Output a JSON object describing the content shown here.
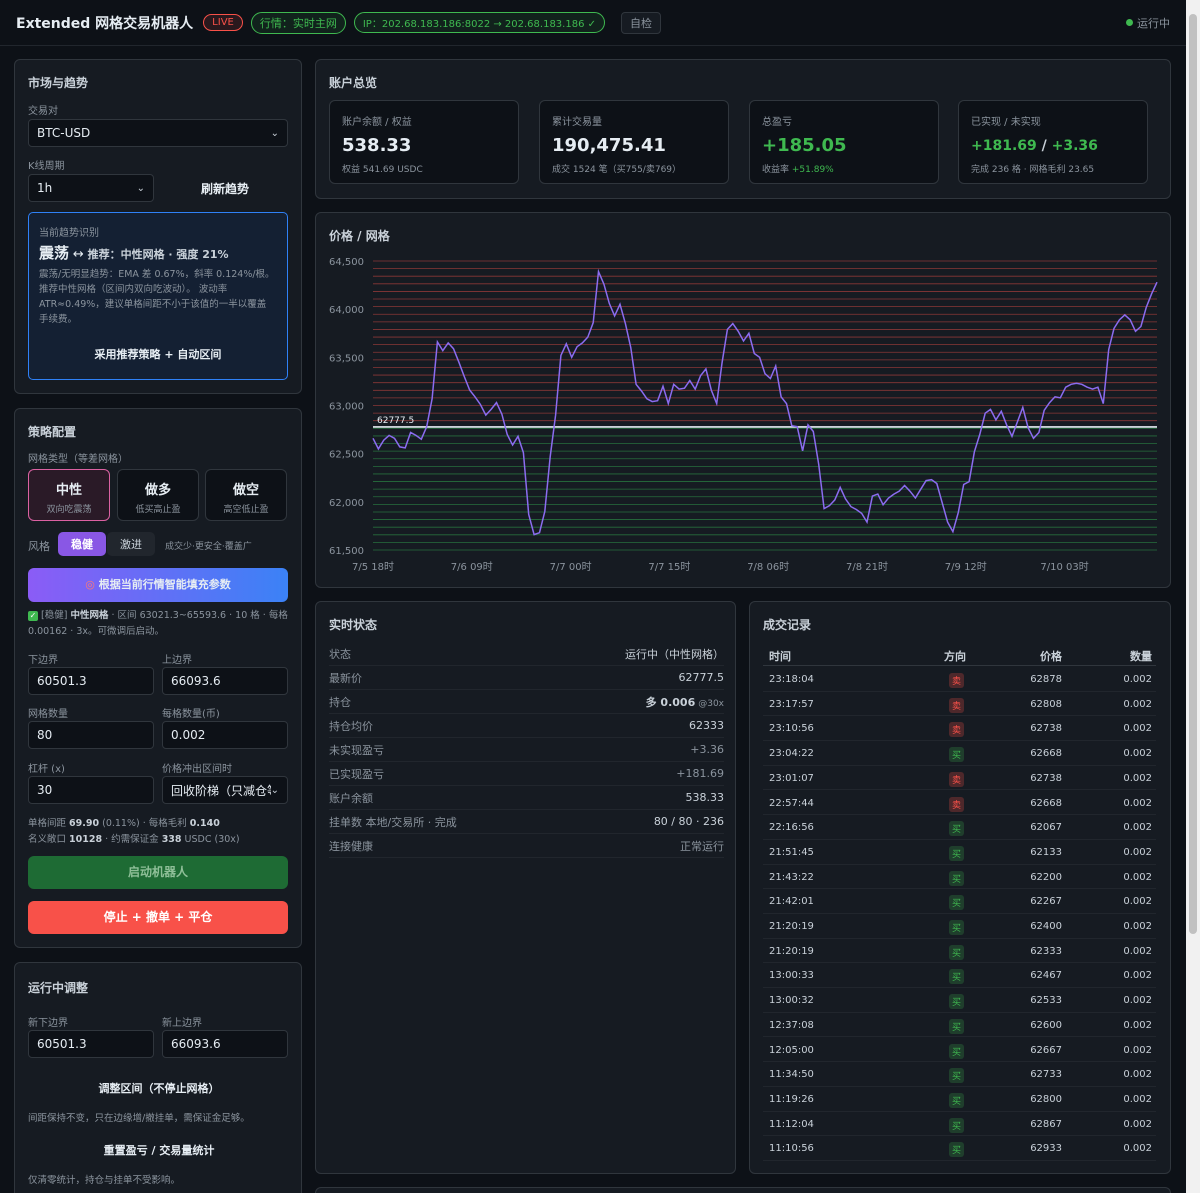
{
  "header": {
    "title": "Extended 网格交易机器人",
    "live": "LIVE",
    "feed": "行情：实时主网",
    "ip": "IP：202.68.183.186:8022 → 202.68.183.186 ✓",
    "check": "自检",
    "run_state": "运行中"
  },
  "market": {
    "title": "市场与趋势",
    "pair_label": "交易对",
    "pair": "BTC-USD",
    "period_label": "K线周期",
    "period": "1h",
    "refresh": "刷新趋势",
    "trend_caption": "当前趋势识别",
    "trend_name": "震荡",
    "trend_arrow": "↔",
    "trend_rec": "推荐：中性网格 · 强度 21%",
    "trend_desc": "震荡/无明显趋势：EMA 差 0.67%，斜率 0.124%/根。推荐中性网格（区间内双向吃波动）。 波动率 ATR≈0.49%，建议单格间距不小于该值的一半以覆盖手续费。",
    "adopt": "采用推荐策略 + 自动区间"
  },
  "strategy": {
    "title": "策略配置",
    "type_label": "网格类型（等差网格）",
    "types": [
      {
        "name": "中性",
        "desc": "双向吃震荡"
      },
      {
        "name": "做多",
        "desc": "低买高止盈"
      },
      {
        "name": "做空",
        "desc": "高空低止盈"
      }
    ],
    "style_label": "风格",
    "style_steady": "稳健",
    "style_aggressive": "激进",
    "style_note": "成交少·更安全·覆盖广",
    "smart_fill": "根据当前行情智能填充参数",
    "fill_note_prefix": "[稳健] ",
    "fill_note_strong": "中性网格",
    "fill_note": " · 区间 63021.3~65593.6 · 10 格 · 每格 0.00162 · 3x。可微调后启动。",
    "lower_label": "下边界",
    "lower": "60501.3",
    "upper_label": "上边界",
    "upper": "66093.6",
    "grids_label": "网格数量",
    "grids": "80",
    "per_grid_label": "每格数量(币)",
    "per_grid": "0.002",
    "leverage_label": "杠杆 (x)",
    "leverage": "30",
    "breakout_label": "价格冲出区间时",
    "breakout": "回收阶梯（只减仓等区间回归）",
    "summary1_a": "单格间距 ",
    "summary1_b": "69.90",
    "summary1_c": " (0.11%) · 每格毛利 ",
    "summary1_d": "0.140",
    "summary2_a": "名义敞口 ",
    "summary2_b": "10128",
    "summary2_c": " · 约需保证金 ",
    "summary2_d": "338",
    "summary2_e": " USDC (30x)",
    "start": "启动机器人",
    "stop": "停止 + 撤单 + 平仓"
  },
  "adjust": {
    "title": "运行中调整",
    "new_lower_label": "新下边界",
    "new_lower": "60501.3",
    "new_upper_label": "新上边界",
    "new_upper": "66093.6",
    "adjust_btn": "调整区间（不停止网格）",
    "adjust_note": "间距保持不变，只在边缘增/撤挂单，需保证金足够。",
    "reset_btn": "重置盈亏 / 交易量统计",
    "reset_note": "仅清零统计，持仓与挂单不受影响。"
  },
  "overview": {
    "title": "账户总览",
    "balance_label": "账户余额 / 权益",
    "balance": "538.33",
    "balance_sub": "权益 541.69 USDC",
    "volume_label": "累计交易量",
    "volume": "190,475.41",
    "volume_sub": "成交 1524 笔（买755/卖769）",
    "pnl_label": "总盈亏",
    "pnl": "+185.05",
    "pnl_sub_a": "收益率 ",
    "pnl_sub_b": "+51.89%",
    "realized_label": "已实现 / 未实现",
    "realized": "+181.69",
    "sep": " / ",
    "unrealized": "+3.36",
    "realized_sub": "完成 236 格 · 网格毛利 23.65"
  },
  "chart_data": {
    "type": "line",
    "title": "价格 / 网格",
    "ylim": [
      61500,
      64500
    ],
    "yticks": [
      "64,500",
      "64,000",
      "63,500",
      "63,000",
      "62,500",
      "62,000",
      "61,500"
    ],
    "xticks": [
      "7/5 18时",
      "7/6 09时",
      "7/7 00时",
      "7/7 15时",
      "7/8 06时",
      "7/8 21时",
      "7/9 12时",
      "7/10 03时"
    ],
    "current_price": 62777.5,
    "current_label": "62777.5",
    "grid_lower": 61500,
    "grid_upper": 64500,
    "grid_count": 39,
    "line_color": "#8b6cf0",
    "values": [
      62660,
      62550,
      62640,
      62690,
      62660,
      62570,
      62560,
      62720,
      62690,
      62650,
      62780,
      63070,
      63660,
      63570,
      63650,
      63590,
      63450,
      63300,
      63160,
      63090,
      63010,
      62900,
      62960,
      63030,
      62910,
      62700,
      62590,
      62680,
      62510,
      61870,
      61660,
      61680,
      61900,
      62470,
      62900,
      63520,
      63640,
      63500,
      63610,
      63650,
      63710,
      63860,
      64390,
      64260,
      64060,
      63930,
      64050,
      63850,
      63600,
      63220,
      63150,
      63070,
      63040,
      63050,
      63200,
      63020,
      63220,
      63170,
      63180,
      63260,
      63170,
      63310,
      63380,
      63160,
      63020,
      63440,
      63790,
      63850,
      63770,
      63670,
      63750,
      63540,
      63500,
      63330,
      63280,
      63410,
      63090,
      63020,
      62790,
      62780,
      62530,
      62800,
      62730,
      62390,
      61930,
      61960,
      62020,
      62150,
      62030,
      61950,
      61920,
      61880,
      61790,
      62060,
      62080,
      61970,
      62040,
      62080,
      62110,
      62170,
      62110,
      62040,
      62130,
      62220,
      62230,
      62190,
      61990,
      61790,
      61690,
      61890,
      62180,
      62210,
      62520,
      62700,
      62920,
      62960,
      62850,
      62940,
      62800,
      62680,
      62830,
      62980,
      62770,
      62660,
      62720,
      62950,
      63030,
      63090,
      63080,
      63190,
      63220,
      63230,
      63220,
      63190,
      63170,
      63190,
      63020,
      63580,
      63800,
      63890,
      63940,
      63890,
      63770,
      63820,
      64020,
      64160,
      64280
    ]
  },
  "realtime": {
    "title": "实时状态",
    "rows": [
      {
        "k": "状态",
        "v": "运行中（中性网格）"
      },
      {
        "k": "最新价",
        "v": "62777.5"
      },
      {
        "k": "持仓",
        "v": "多 0.006",
        "v2": "@30x"
      },
      {
        "k": "持仓均价",
        "v": "62333"
      },
      {
        "k": "未实现盈亏",
        "v": "+3.36"
      },
      {
        "k": "已实现盈亏",
        "v": "+181.69"
      },
      {
        "k": "账户余额",
        "v": "538.33"
      },
      {
        "k": "挂单数 本地/交易所 · 完成",
        "v": "80 / 80 · 236"
      },
      {
        "k": "连接健康",
        "v": "正常运行"
      }
    ]
  },
  "trades": {
    "title": "成交记录",
    "headers": [
      "时间",
      "方向",
      "价格",
      "数量"
    ],
    "rows": [
      [
        "23:18:04",
        "卖",
        "62878",
        "0.002"
      ],
      [
        "23:17:57",
        "卖",
        "62808",
        "0.002"
      ],
      [
        "23:10:56",
        "卖",
        "62738",
        "0.002"
      ],
      [
        "23:04:22",
        "买",
        "62668",
        "0.002"
      ],
      [
        "23:01:07",
        "卖",
        "62738",
        "0.002"
      ],
      [
        "22:57:44",
        "卖",
        "62668",
        "0.002"
      ],
      [
        "22:16:56",
        "买",
        "62067",
        "0.002"
      ],
      [
        "21:51:45",
        "买",
        "62133",
        "0.002"
      ],
      [
        "21:43:22",
        "买",
        "62200",
        "0.002"
      ],
      [
        "21:42:01",
        "买",
        "62267",
        "0.002"
      ],
      [
        "21:20:19",
        "买",
        "62400",
        "0.002"
      ],
      [
        "21:20:19",
        "买",
        "62333",
        "0.002"
      ],
      [
        "13:00:33",
        "买",
        "62467",
        "0.002"
      ],
      [
        "13:00:32",
        "买",
        "62533",
        "0.002"
      ],
      [
        "12:37:08",
        "买",
        "62600",
        "0.002"
      ],
      [
        "12:05:00",
        "买",
        "62667",
        "0.002"
      ],
      [
        "11:34:50",
        "买",
        "62733",
        "0.002"
      ],
      [
        "11:19:26",
        "买",
        "62800",
        "0.002"
      ],
      [
        "11:12:04",
        "买",
        "62867",
        "0.002"
      ],
      [
        "11:10:56",
        "买",
        "62933",
        "0.002"
      ]
    ]
  }
}
